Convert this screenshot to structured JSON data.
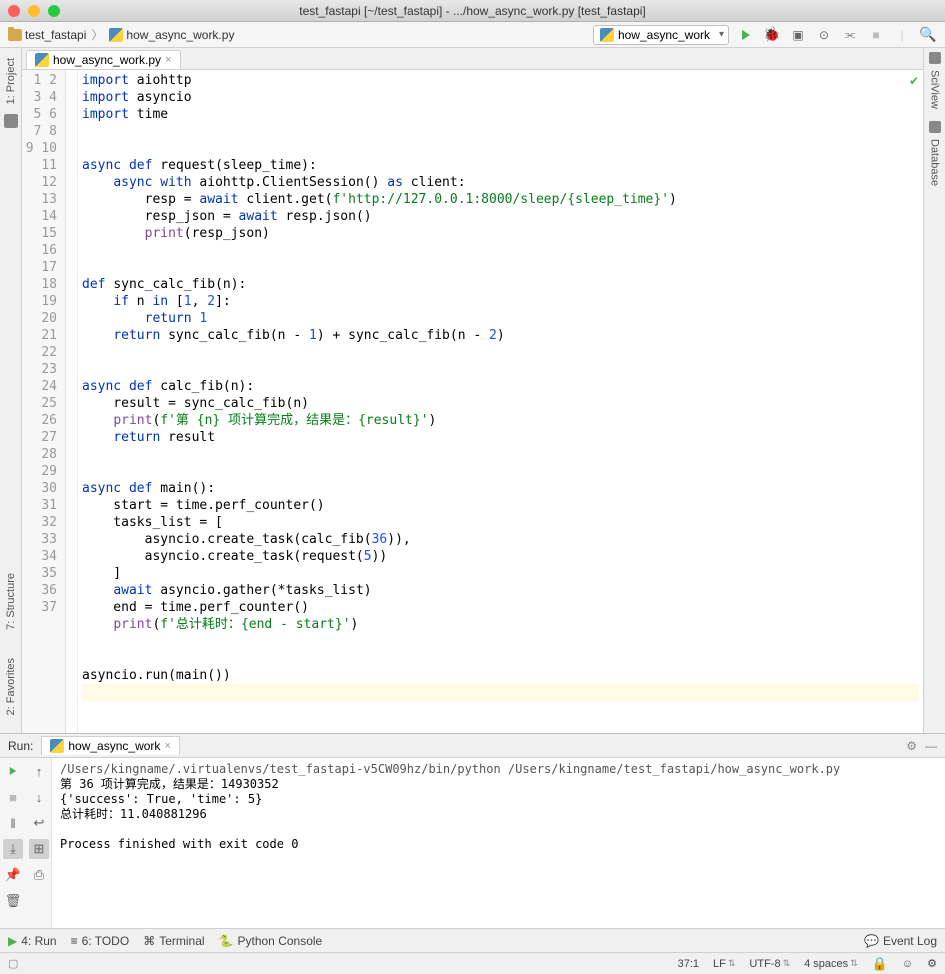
{
  "window": {
    "title": "test_fastapi [~/test_fastapi] - .../how_async_work.py [test_fastapi]"
  },
  "breadcrumb": {
    "items": [
      {
        "label": "test_fastapi"
      },
      {
        "label": "how_async_work.py"
      }
    ]
  },
  "toolbar": {
    "run_config": "how_async_work"
  },
  "editor": {
    "tab_name": "how_async_work.py",
    "last_line": 37,
    "code_lines": [
      [
        [
          "kw",
          "import"
        ],
        [
          "",
          " aiohttp"
        ]
      ],
      [
        [
          "kw",
          "import"
        ],
        [
          "",
          " asyncio"
        ]
      ],
      [
        [
          "kw",
          "import"
        ],
        [
          "",
          " time"
        ]
      ],
      [],
      [],
      [
        [
          "kw",
          "async def "
        ],
        [
          "fn",
          "request"
        ],
        [
          "",
          "(sleep_time):"
        ]
      ],
      [
        [
          "",
          "    "
        ],
        [
          "kw",
          "async with"
        ],
        [
          "",
          " aiohttp.ClientSession() "
        ],
        [
          "kw",
          "as"
        ],
        [
          "",
          " client:"
        ]
      ],
      [
        [
          "",
          "        resp = "
        ],
        [
          "kw",
          "await"
        ],
        [
          "",
          " client.get("
        ],
        [
          "str",
          "f'http://127.0.0.1:8000/sleep/"
        ],
        [
          "cn",
          "{sleep_time}"
        ],
        [
          "str",
          "'"
        ],
        [
          "",
          ")"
        ]
      ],
      [
        [
          "",
          "        resp_json = "
        ],
        [
          "kw",
          "await"
        ],
        [
          "",
          " resp.json()"
        ]
      ],
      [
        [
          "",
          "        "
        ],
        [
          "def",
          "print"
        ],
        [
          "",
          "(resp_json)"
        ]
      ],
      [],
      [],
      [
        [
          "kw",
          "def "
        ],
        [
          "fn",
          "sync_calc_fib"
        ],
        [
          "",
          "(n):"
        ]
      ],
      [
        [
          "",
          "    "
        ],
        [
          "kw",
          "if"
        ],
        [
          "",
          " n "
        ],
        [
          "kw",
          "in"
        ],
        [
          "",
          " ["
        ],
        [
          "num",
          "1"
        ],
        [
          "",
          ", "
        ],
        [
          "num",
          "2"
        ],
        [
          "",
          "]:"
        ]
      ],
      [
        [
          "",
          "        "
        ],
        [
          "kw",
          "return "
        ],
        [
          "num",
          "1"
        ]
      ],
      [
        [
          "",
          "    "
        ],
        [
          "kw",
          "return"
        ],
        [
          "",
          " sync_calc_fib(n - "
        ],
        [
          "num",
          "1"
        ],
        [
          "",
          ") + sync_calc_fib(n - "
        ],
        [
          "num",
          "2"
        ],
        [
          "",
          ")"
        ]
      ],
      [],
      [],
      [
        [
          "kw",
          "async def "
        ],
        [
          "fn",
          "calc_fib"
        ],
        [
          "",
          "(n):"
        ]
      ],
      [
        [
          "",
          "    result = sync_calc_fib(n)"
        ]
      ],
      [
        [
          "",
          "    "
        ],
        [
          "def",
          "print"
        ],
        [
          "",
          "("
        ],
        [
          "str",
          "f'第 "
        ],
        [
          "cn",
          "{n}"
        ],
        [
          "str",
          " 项计算完成，结果是："
        ],
        [
          "cn",
          "{result}"
        ],
        [
          "str",
          "'"
        ],
        [
          "",
          ")"
        ]
      ],
      [
        [
          "",
          "    "
        ],
        [
          "kw",
          "return"
        ],
        [
          "",
          " result"
        ]
      ],
      [],
      [],
      [
        [
          "kw",
          "async def "
        ],
        [
          "fn",
          "main"
        ],
        [
          "",
          "():"
        ]
      ],
      [
        [
          "",
          "    start = time.perf_counter()"
        ]
      ],
      [
        [
          "",
          "    tasks_list = ["
        ]
      ],
      [
        [
          "",
          "        asyncio.create_task(calc_fib("
        ],
        [
          "num",
          "36"
        ],
        [
          "",
          ")),"
        ]
      ],
      [
        [
          "",
          "        asyncio.create_task(request("
        ],
        [
          "num",
          "5"
        ],
        [
          "",
          "))"
        ]
      ],
      [
        [
          "",
          "    ]"
        ]
      ],
      [
        [
          "",
          "    "
        ],
        [
          "kw",
          "await"
        ],
        [
          "",
          " asyncio.gather(*tasks_list)"
        ]
      ],
      [
        [
          "",
          "    end = time.perf_counter()"
        ]
      ],
      [
        [
          "",
          "    "
        ],
        [
          "def",
          "print"
        ],
        [
          "",
          "("
        ],
        [
          "str",
          "f'总计耗时："
        ],
        [
          "cn",
          "{end - start}"
        ],
        [
          "str",
          "'"
        ],
        [
          "",
          ")"
        ]
      ],
      [],
      [],
      [
        [
          "",
          "asyncio.run(main())"
        ]
      ],
      []
    ]
  },
  "left_rail": {
    "tabs": [
      {
        "label": "1: Project",
        "underline": "1"
      },
      {
        "label": "7: Structure",
        "underline": "7"
      },
      {
        "label": "2: Favorites",
        "underline": "2"
      }
    ]
  },
  "right_rail": {
    "tabs": [
      {
        "label": "SciView"
      },
      {
        "label": "Database"
      }
    ]
  },
  "run": {
    "header_label": "Run:",
    "tab_name": "how_async_work",
    "console_lines": [
      {
        "cls": "path",
        "text": "/Users/kingname/.virtualenvs/test_fastapi-v5CW09hz/bin/python /Users/kingname/test_fastapi/how_async_work.py"
      },
      {
        "cls": "",
        "text": "第 36 项计算完成，结果是：14930352"
      },
      {
        "cls": "",
        "text": "{'success': True, 'time': 5}"
      },
      {
        "cls": "",
        "text": "总计耗时：11.040881296"
      },
      {
        "cls": "",
        "text": ""
      },
      {
        "cls": "exit",
        "text": "Process finished with exit code 0"
      }
    ]
  },
  "bottom_bar": {
    "items": [
      {
        "label": "4: Run",
        "underline": "4",
        "icon": "▶"
      },
      {
        "label": "6: TODO",
        "underline": "6",
        "icon": "≡"
      },
      {
        "label": "Terminal",
        "icon": "⌘"
      },
      {
        "label": "Python Console",
        "icon": "🐍"
      }
    ],
    "event_log": "Event Log"
  },
  "status": {
    "cursor": "37:1",
    "line_ending": "LF",
    "encoding": "UTF-8",
    "indent": "4 spaces"
  }
}
